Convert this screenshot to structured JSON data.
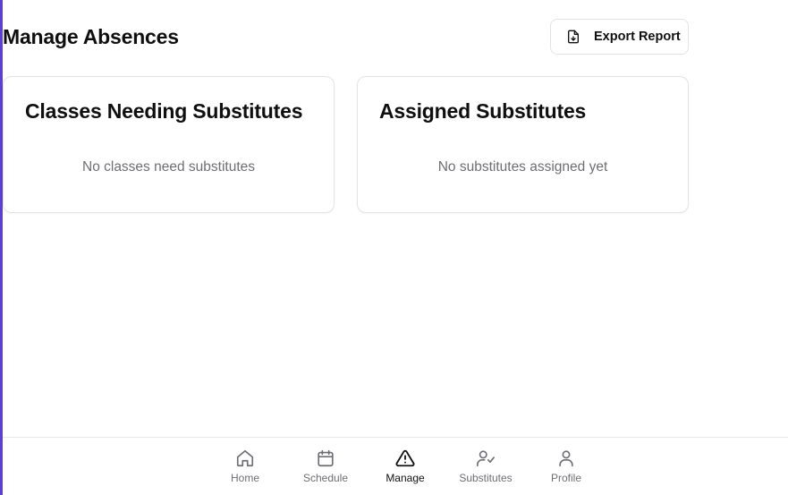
{
  "header": {
    "title": "Manage Absences",
    "export_label": "Export Report",
    "export_icon": "file-download-icon"
  },
  "cards": [
    {
      "title": "Classes Needing Substitutes",
      "empty_text": "No classes need substitutes"
    },
    {
      "title": "Assigned Substitutes",
      "empty_text": "No substitutes assigned yet"
    }
  ],
  "nav": {
    "active": "Manage",
    "items": [
      {
        "label": "Home",
        "icon": "home-icon"
      },
      {
        "label": "Schedule",
        "icon": "calendar-icon"
      },
      {
        "label": "Manage",
        "icon": "alert-triangle-icon"
      },
      {
        "label": "Substitutes",
        "icon": "user-check-icon"
      },
      {
        "label": "Profile",
        "icon": "user-icon"
      }
    ]
  },
  "colors": {
    "accent_border": "#5b3fd6",
    "text": "#0f0f10",
    "muted": "#6e6e73",
    "border": "#e3e3e7"
  }
}
